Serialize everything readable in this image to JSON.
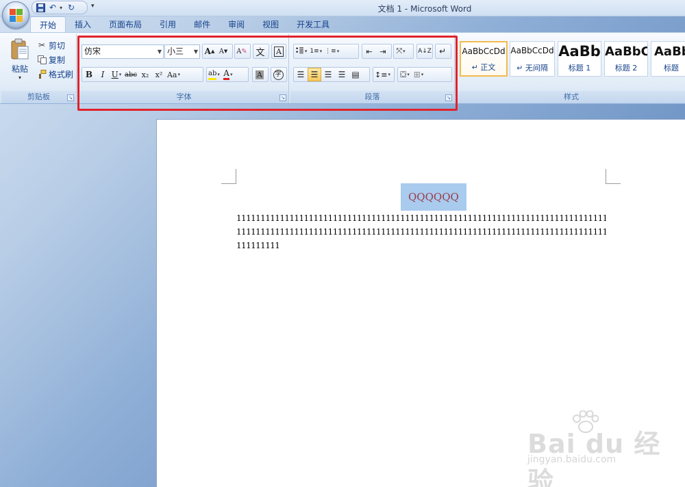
{
  "window": {
    "title": "文档 1 - Microsoft Word"
  },
  "qat": {
    "icons": [
      "save-icon",
      "undo-icon",
      "redo-icon"
    ],
    "more": "▾"
  },
  "tabs": [
    {
      "label": "开始",
      "active": true
    },
    {
      "label": "插入"
    },
    {
      "label": "页面布局"
    },
    {
      "label": "引用"
    },
    {
      "label": "邮件"
    },
    {
      "label": "审阅"
    },
    {
      "label": "视图"
    },
    {
      "label": "开发工具"
    }
  ],
  "clipboard": {
    "paste": "粘贴",
    "cut": "剪切",
    "copy": "复制",
    "format_painter": "格式刷",
    "group_label": "剪贴板"
  },
  "font": {
    "font_name": "仿宋",
    "font_size": "小三",
    "group_label": "字体",
    "grow": "A",
    "shrink": "A",
    "bold": "B",
    "italic": "I",
    "underline": "U",
    "strike": "abc",
    "subscript": "x₂",
    "superscript": "x²",
    "change_case": "Aa",
    "highlight": "ab",
    "font_color": "A",
    "char_shading": "A",
    "enclose": "字",
    "char_border": "A",
    "phonetic": "文",
    "clear_format": "A"
  },
  "paragraph": {
    "group_label": "段落"
  },
  "styles": {
    "group_label": "样式",
    "items": [
      {
        "sample": "AaBbCcDd",
        "name": "↵ 正文",
        "selected": true
      },
      {
        "sample": "AaBbCcDd",
        "name": "↵ 无间隔"
      },
      {
        "sample": "AaBb",
        "name": "标题 1"
      },
      {
        "sample": "AaBbC",
        "name": "标题 2"
      },
      {
        "sample": "AaBb",
        "name": "标题"
      }
    ]
  },
  "document": {
    "heading": "QQQQQQ",
    "lines": [
      "11111111111111111111111111111111111111111111111111111111111111111111111111111111111111111",
      "11111111111111111111111111111111111111111111111111111111111111111111111111111111111111111",
      "111111111"
    ]
  },
  "watermark": {
    "brand": "Bai du 经验",
    "url": "jingyan.baidu.com"
  },
  "colors": {
    "highlight_box": "#e0222a",
    "selection": "#a9cbee",
    "heading_text": "#9a3a47"
  }
}
